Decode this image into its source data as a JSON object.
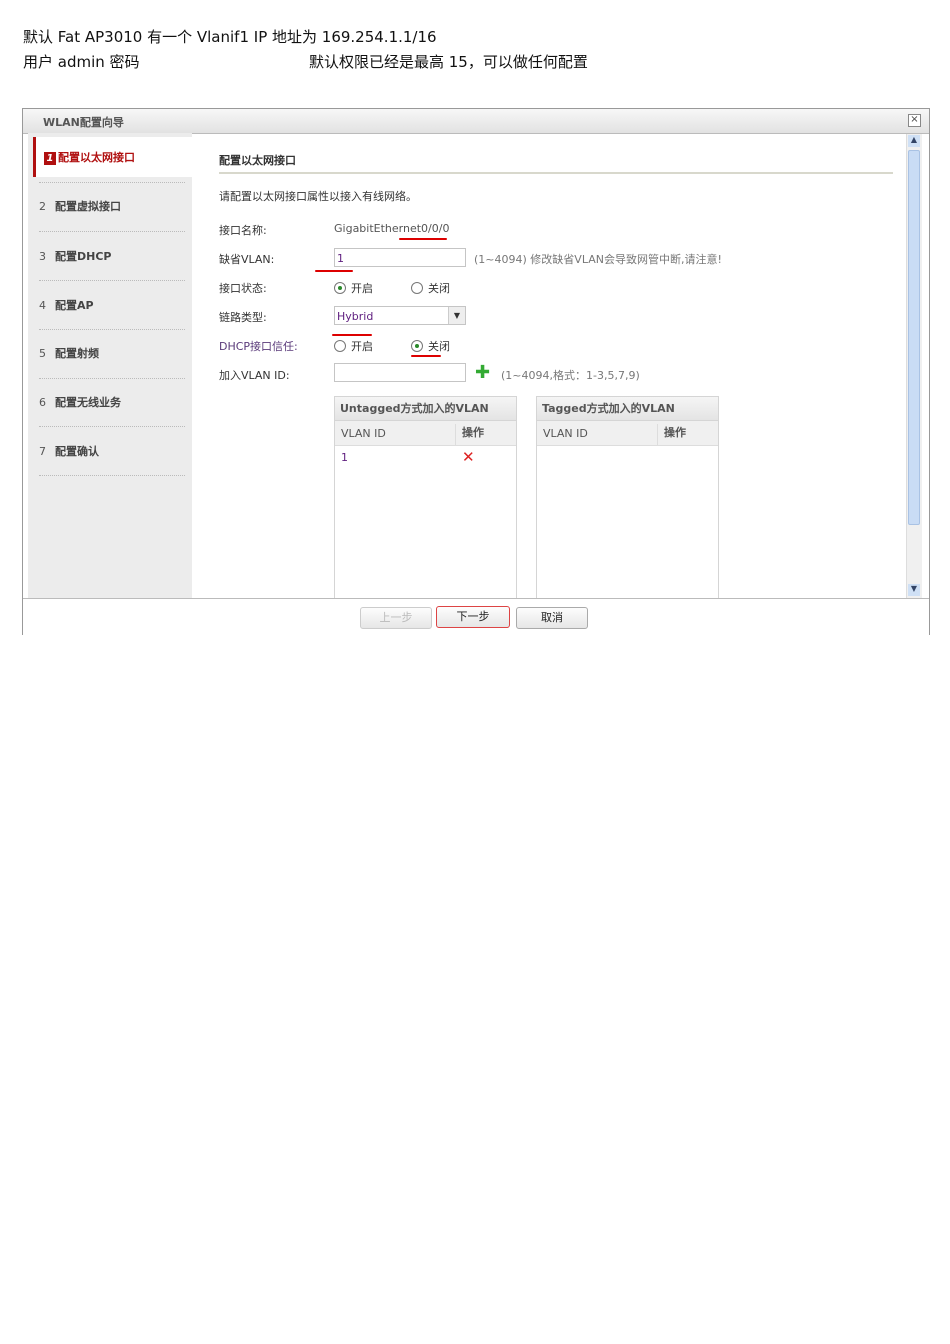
{
  "header": {
    "line1": "默认 Fat AP3010  有一个 Vlanif1 IP 地址为 169.254.1.1/16",
    "line2a": "用户 admin  密码",
    "line2b": "默认权限已经是最高 15，可以做任何配置"
  },
  "window": {
    "title": "WLAN配置向导",
    "close": "×"
  },
  "steps": [
    {
      "num": "1",
      "label": "配置以太网接口"
    },
    {
      "num": "2",
      "label": "配置虚拟接口"
    },
    {
      "num": "3",
      "label": "配置DHCP"
    },
    {
      "num": "4",
      "label": "配置AP"
    },
    {
      "num": "5",
      "label": "配置射频"
    },
    {
      "num": "6",
      "label": "配置无线业务"
    },
    {
      "num": "7",
      "label": "配置确认"
    }
  ],
  "form": {
    "heading": "配置以太网接口",
    "intro": "请配置以太网接口属性以接入有线网络。",
    "iface_label": "接口名称:",
    "iface_value": "GigabitEthernet0/0/0",
    "vlan_label": "缺省VLAN:",
    "vlan_value": "1",
    "vlan_hint": "(1~4094) 修改缺省VLAN会导致网管中断,请注意!",
    "state_label": "接口状态:",
    "on": "开启",
    "off": "关闭",
    "link_label": "链路类型:",
    "link_value": "Hybrid",
    "dhcp_label": "DHCP接口信任:",
    "add_label": "加入VLAN ID:",
    "add_value": "",
    "add_hint": "(1~4094,格式：1-3,5,7,9)"
  },
  "untagged": {
    "title": "Untagged方式加入的VLAN",
    "col1": "VLAN ID",
    "col2": "操作",
    "rows": [
      {
        "id": "1"
      }
    ]
  },
  "tagged": {
    "title": "Tagged方式加入的VLAN",
    "col1": "VLAN ID",
    "col2": "操作"
  },
  "footer": {
    "prev": "上一步",
    "next": "下一步",
    "cancel": "取消"
  }
}
